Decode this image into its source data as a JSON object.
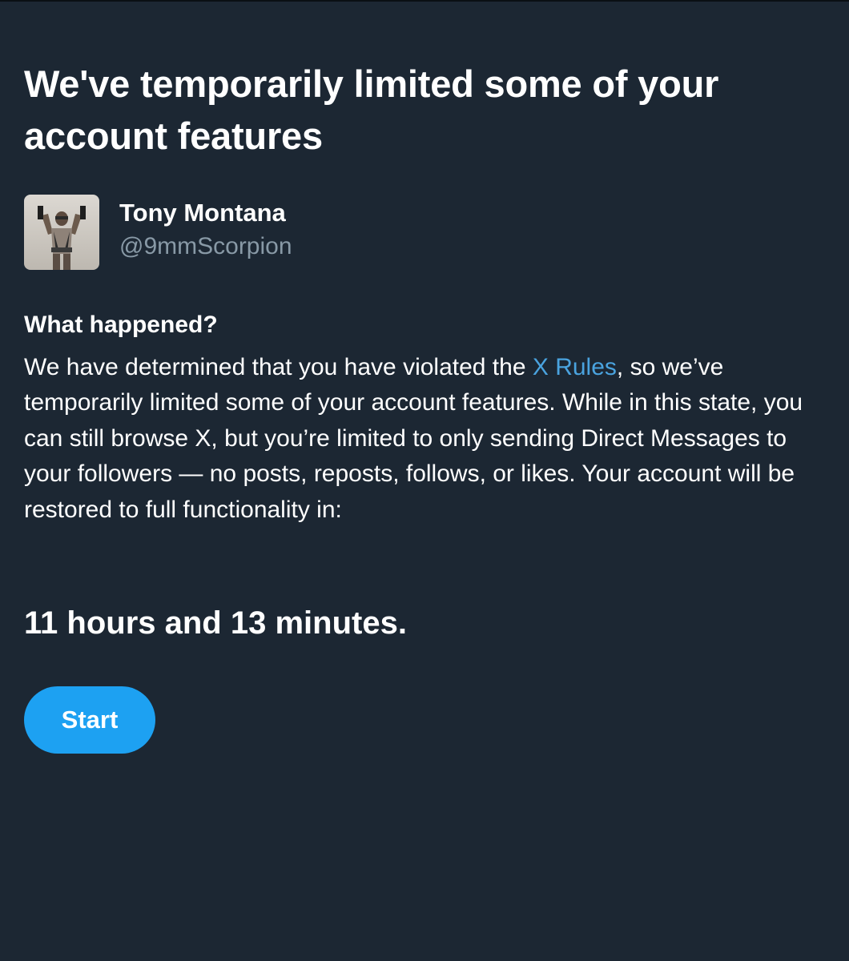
{
  "header": {
    "title": "We've temporarily limited some of your account features"
  },
  "profile": {
    "display_name": "Tony Montana",
    "handle": "@9mmScorpion"
  },
  "notice": {
    "heading": "What happened?",
    "text_before_link": "We have determined that you have violated the ",
    "link_label": "X Rules",
    "text_after_link": ", so we’ve temporarily limited some of your account features. While in this state, you can still browse X, but you’re limited to only sending Direct Messages to your followers — no posts, reposts, follows, or likes. Your account will be restored to full functionality in:"
  },
  "countdown": {
    "text": "11 hours and 13 minutes."
  },
  "actions": {
    "start_label": "Start"
  },
  "colors": {
    "background": "#1c2733",
    "accent": "#1da1f2",
    "link": "#4aa3df",
    "secondary_text": "#8899a6"
  }
}
